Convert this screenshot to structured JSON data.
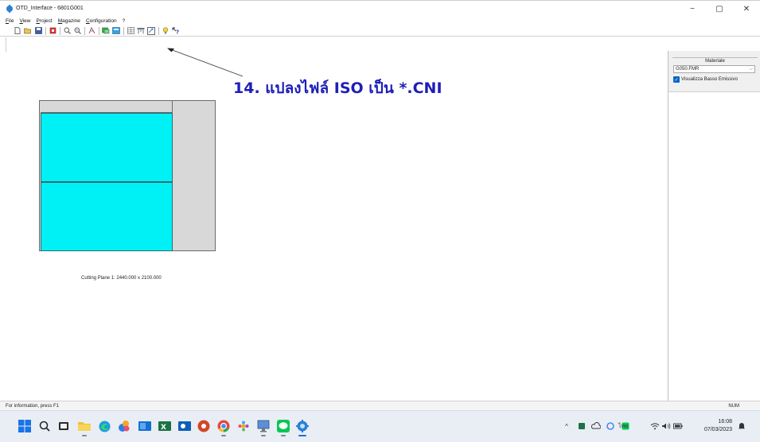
{
  "window": {
    "title": "OTD_Interface - 6801G001",
    "minimize_glyph": "−",
    "maximize_glyph": "▢",
    "close_glyph": "✕"
  },
  "menu": {
    "items": [
      "File",
      "View",
      "Project",
      "Magazine",
      "Configuration",
      "?"
    ]
  },
  "toolbar": {
    "buttons": [
      "new-icon",
      "open-icon",
      "save-icon",
      "print-icon",
      "zoom-icon",
      "zoom-out-icon",
      "pattern-icon",
      "layers-icon",
      "stack-icon",
      "table-icon",
      "machine-icon",
      "convert-icon",
      "light-icon",
      "help-icon"
    ]
  },
  "annotation": {
    "text": "14. แปลงไฟล์ ISO เป็น  *.CNI",
    "color": "#1e1eb8"
  },
  "sheet": {
    "piece_color": "#00f1f5",
    "label": "Cutting Plane 1: 2440.000 x 2100.000"
  },
  "right_panel": {
    "material_label": "Materiale",
    "material_value": "G050.FMR",
    "checkbox_label": "Visualizza Basso Emissivo",
    "checkbox_checked": true
  },
  "status_bar": {
    "text": "For information, press F1",
    "num": "NUM"
  },
  "taskbar": {
    "apps": [
      "windows-start-icon",
      "search-icon",
      "task-view-icon",
      "file-explorer-icon",
      "edge-icon",
      "photos-icon",
      "mail-icon",
      "excel-icon",
      "powerpoint-icon",
      "chrome-icon",
      "app-icon",
      "remote-desktop-icon",
      "line-icon",
      "otd-interface-icon"
    ],
    "language": "ไทย",
    "time": "16:08",
    "date": "07/03/2023"
  }
}
